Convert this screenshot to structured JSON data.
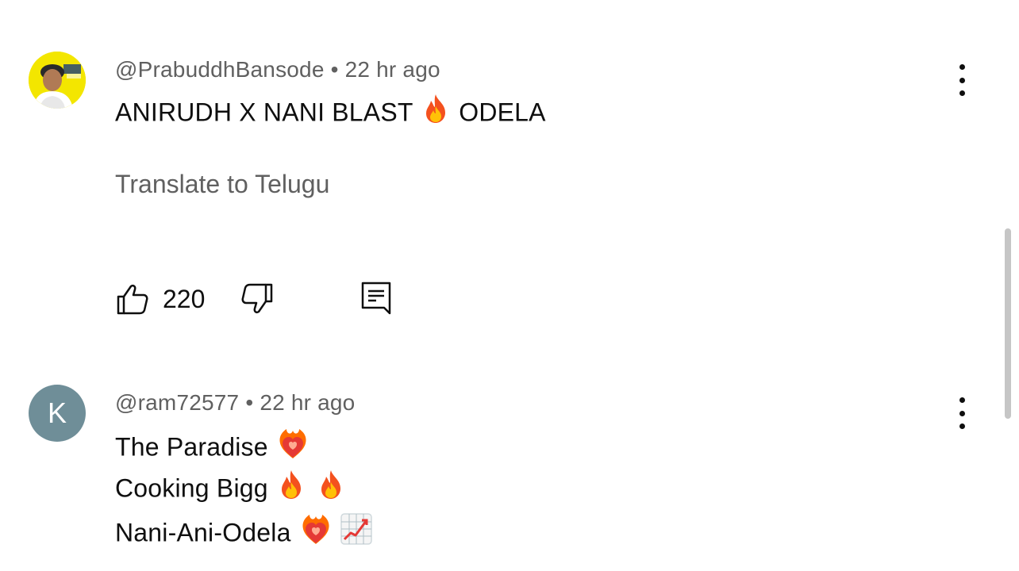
{
  "comments": [
    {
      "username": "@PrabuddhBansode",
      "separator": "•",
      "time": "22 hr ago",
      "avatar_icon": "profile-photo",
      "lines": [
        {
          "parts": [
            "ANIRUDH X NANI  BLAST ",
            "fire-emoji",
            " ODELA"
          ]
        }
      ],
      "translate_label": "Translate to Telugu",
      "like_count": "220",
      "menu_icon": "more-vert-icon"
    },
    {
      "username": "@ram72577",
      "separator": "•",
      "time": "22 hr ago",
      "avatar_letter": "K",
      "avatar_color": "#6f8e98",
      "lines": [
        {
          "text": "The Paradise "
        },
        {
          "text": "Cooking Bigg "
        },
        {
          "text": "Nani-Ani-Odela "
        }
      ],
      "menu_icon": "more-vert-icon"
    }
  ],
  "icons": {
    "like": "thumb-up-outline-icon",
    "dislike": "thumb-down-outline-icon",
    "reply": "comment-reply-icon",
    "fire": "fire-emoji",
    "heart": "heart-on-fire-emoji",
    "chart": "chart-increasing-emoji"
  },
  "colors": {
    "text_primary": "#0f0f0f",
    "text_secondary": "#606060",
    "avatar_k": "#6f8e98",
    "avatar_photo_bg": "#f3e600"
  }
}
